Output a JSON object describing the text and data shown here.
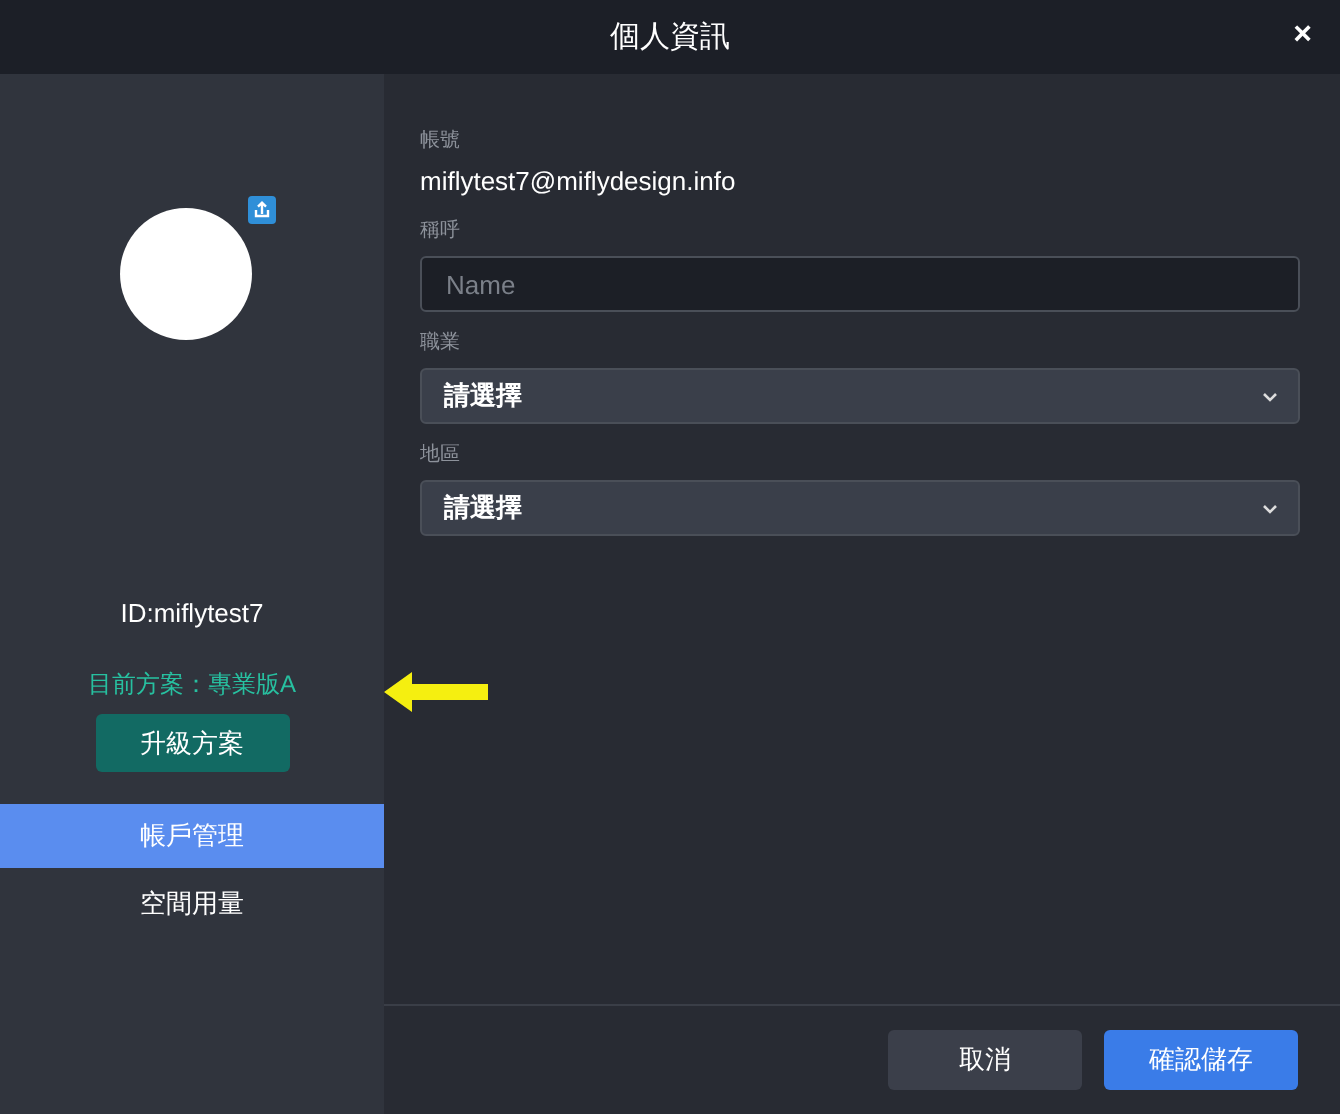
{
  "window": {
    "title": "個人資訊",
    "close": "×"
  },
  "sidebar": {
    "user_id": "ID:miflytest7",
    "plan": "目前方案：專業版A",
    "upgrade_button": "升級方案",
    "items": [
      {
        "label": "帳戶管理",
        "selected": true
      },
      {
        "label": "空間用量",
        "selected": false
      }
    ]
  },
  "form": {
    "fields": [
      {
        "kind": "static",
        "label": "帳號",
        "value": "miflytest7@miflydesign.info"
      },
      {
        "kind": "input",
        "label": "稱呼",
        "placeholder": "Name"
      },
      {
        "kind": "select",
        "label": "職業",
        "value": "請選擇"
      },
      {
        "kind": "select",
        "label": "地區",
        "value": "請選擇"
      }
    ]
  },
  "buttons": [
    {
      "kind": "secondary",
      "label": "取消"
    },
    {
      "kind": "primary",
      "label": "確認儲存"
    }
  ]
}
